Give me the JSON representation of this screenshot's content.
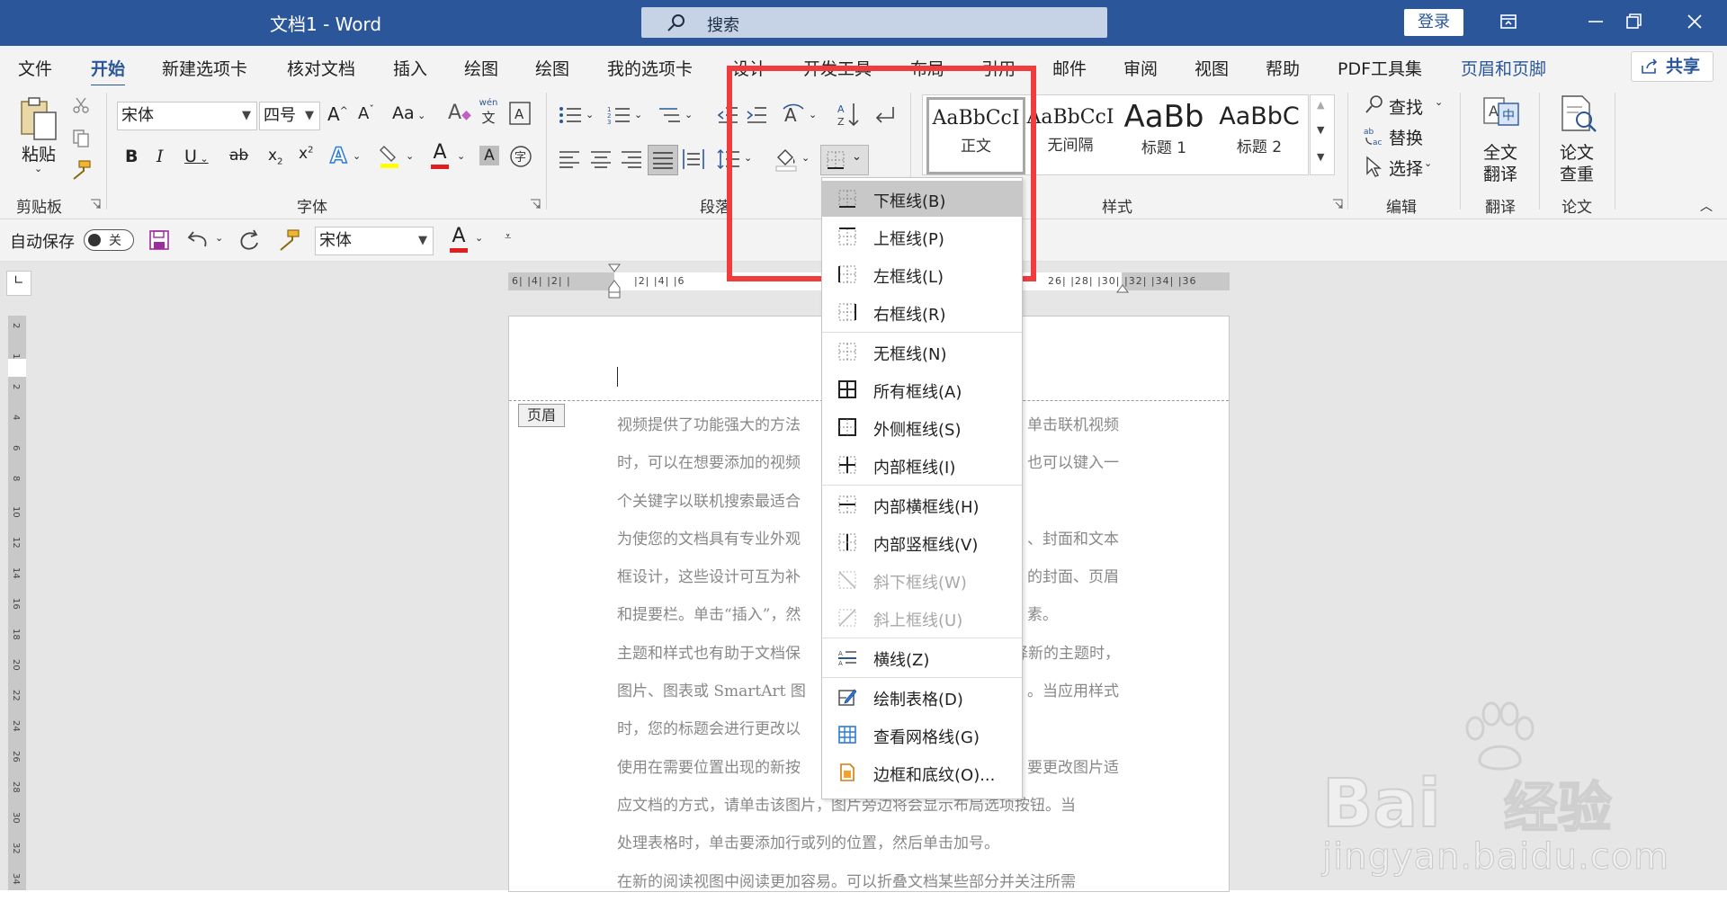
{
  "app": {
    "title": "文档1 - Word",
    "search_label": "搜索",
    "login_label": "登录"
  },
  "tabs": [
    {
      "label": "文件"
    },
    {
      "label": "开始"
    },
    {
      "label": "新建选项卡"
    },
    {
      "label": "核对文档"
    },
    {
      "label": "插入"
    },
    {
      "label": "绘图"
    },
    {
      "label": "绘图"
    },
    {
      "label": "我的选项卡"
    },
    {
      "label": "设计"
    },
    {
      "label": "开发工具"
    },
    {
      "label": "布局"
    },
    {
      "label": "引用"
    },
    {
      "label": "邮件"
    },
    {
      "label": "审阅"
    },
    {
      "label": "视图"
    },
    {
      "label": "帮助"
    },
    {
      "label": "PDF工具集"
    },
    {
      "label": "页眉和页脚"
    }
  ],
  "share_label": "共享",
  "ribbon": {
    "paste_label": "粘贴",
    "font_name": "宋体",
    "font_size": "四号",
    "phonetic_top": "wén",
    "phonetic_bottom": "文",
    "styles": [
      {
        "sample": "AaBbCcI",
        "name": "正文"
      },
      {
        "sample": "AaBbCcI",
        "name": "无间隔"
      },
      {
        "sample": "AaBb",
        "name": "标题 1"
      },
      {
        "sample": "AaBbC",
        "name": "标题 2"
      }
    ],
    "find_label": "查找",
    "replace_label": "替换",
    "select_label": "选择",
    "translate_label_1": "全文",
    "translate_label_2": "翻译",
    "paper_label_1": "论文",
    "paper_label_2": "查重",
    "groups": {
      "clipboard": "剪贴板",
      "font": "字体",
      "paragraph": "段落",
      "styles": "样式",
      "editing": "编辑",
      "translate": "翻译",
      "paper": "论文"
    }
  },
  "qat": {
    "autosave_label": "自动保存",
    "toggle_state": "关",
    "font_name": "宋体"
  },
  "ruler": {
    "h_left": "6| |4| |2| |",
    "h_mid": "|2| |4| |6",
    "h_right": "26| |28| |30| |32| |34| |36",
    "v_ticks": [
      "2",
      "1",
      "2",
      "4",
      "6",
      "8",
      "10",
      "12",
      "14",
      "16",
      "18",
      "20",
      "22",
      "24",
      "26",
      "28",
      "30",
      "32",
      "34"
    ]
  },
  "document": {
    "header_tag": "页眉",
    "lines": [
      {
        "left": "视频提供了功能强大的方法",
        "right": "单击联机视频"
      },
      {
        "left": "时，可以在想要添加的视频",
        "right": "也可以键入一"
      },
      {
        "left": "个关键字以联机搜索最适合",
        "right": ""
      },
      {
        "left": "为使您的文档具有专业外观",
        "right": "、封面和文本"
      },
      {
        "left": "框设计，这些设计可互为补",
        "right": "的封面、页眉"
      },
      {
        "left": "和提要栏。单击“插入”，然",
        "right": "素。"
      },
      {
        "left": "主题和样式也有助于文档保",
        "right": "择新的主题时，"
      },
      {
        "left": "图片、图表或 SmartArt 图",
        "right": "。当应用样式"
      },
      {
        "left": "时，您的标题会进行更改以",
        "right": ""
      },
      {
        "left": "使用在需要位置出现的新按",
        "right": "要更改图片适"
      },
      {
        "left": "应文档的方式，请单击该图片，图片旁边将会显示布局选项按钮。当",
        "right": ""
      },
      {
        "left": "处理表格时，单击要添加行或列的位置，然后单击加号。",
        "right": ""
      },
      {
        "left": "在新的阅读视图中阅读更加容易。可以折叠文档某些部分并关注所需",
        "right": ""
      }
    ]
  },
  "border_menu": [
    {
      "label": "下框线(B)",
      "icon": "bottom-border-icon",
      "disabled": false
    },
    {
      "label": "上框线(P)",
      "icon": "top-border-icon",
      "disabled": false
    },
    {
      "label": "左框线(L)",
      "icon": "left-border-icon",
      "disabled": false
    },
    {
      "label": "右框线(R)",
      "icon": "right-border-icon",
      "disabled": false
    },
    {
      "label": "无框线(N)",
      "icon": "no-border-icon",
      "disabled": false
    },
    {
      "label": "所有框线(A)",
      "icon": "all-borders-icon",
      "disabled": false
    },
    {
      "label": "外侧框线(S)",
      "icon": "outside-borders-icon",
      "disabled": false
    },
    {
      "label": "内部框线(I)",
      "icon": "inside-borders-icon",
      "disabled": false
    },
    {
      "label": "内部横框线(H)",
      "icon": "inside-horizontal-border-icon",
      "disabled": false
    },
    {
      "label": "内部竖框线(V)",
      "icon": "inside-vertical-border-icon",
      "disabled": false
    },
    {
      "label": "斜下框线(W)",
      "icon": "diagonal-down-border-icon",
      "disabled": true
    },
    {
      "label": "斜上框线(U)",
      "icon": "diagonal-up-border-icon",
      "disabled": true
    },
    {
      "label": "横线(Z)",
      "icon": "horizontal-line-icon",
      "disabled": false
    },
    {
      "label": "绘制表格(D)",
      "icon": "draw-table-icon",
      "disabled": false
    },
    {
      "label": "查看网格线(G)",
      "icon": "view-gridlines-icon",
      "disabled": false
    },
    {
      "label": "边框和底纹(O)...",
      "icon": "borders-shading-icon",
      "disabled": false
    }
  ],
  "watermark": {
    "brand": "Bai",
    "brand_suffix": "经验",
    "url": "jingyan.baidu.com"
  },
  "colors": {
    "accent": "#2b579a",
    "highlight_box": "#f03c3c",
    "font_color_bar": "#e02020",
    "highlight_bar": "#ffff00"
  }
}
